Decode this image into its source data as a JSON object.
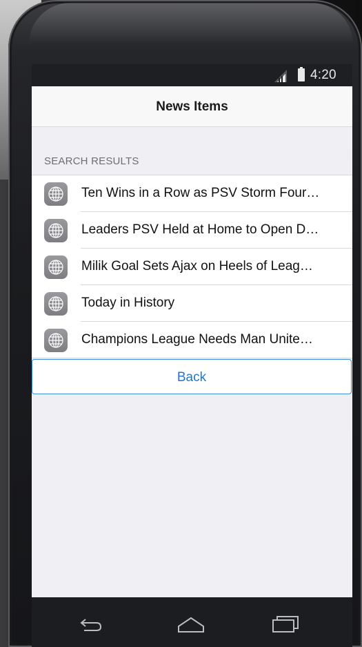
{
  "status_bar": {
    "time": "4:20",
    "icons": [
      "signal-icon",
      "battery-icon"
    ]
  },
  "nav_bar": {
    "title": "News Items"
  },
  "section": {
    "header": "SEARCH RESULTS"
  },
  "items": [
    {
      "icon": "globe-icon",
      "label": "Ten Wins in a Row as PSV Storm Four…"
    },
    {
      "icon": "globe-icon",
      "label": "Leaders PSV Held at Home to Open D…"
    },
    {
      "icon": "globe-icon",
      "label": "Milik Goal Sets Ajax on Heels of Leag…"
    },
    {
      "icon": "globe-icon",
      "label": "Today in History"
    },
    {
      "icon": "globe-icon",
      "label": "Champions League Needs Man Unite…"
    }
  ],
  "back_button": {
    "label": "Back"
  },
  "softkeys": [
    "back-arrow-icon",
    "home-icon",
    "recents-icon"
  ],
  "colors": {
    "accent": "#1b76d8",
    "background": "#efeff4",
    "status_bar": "#1e1f22"
  }
}
